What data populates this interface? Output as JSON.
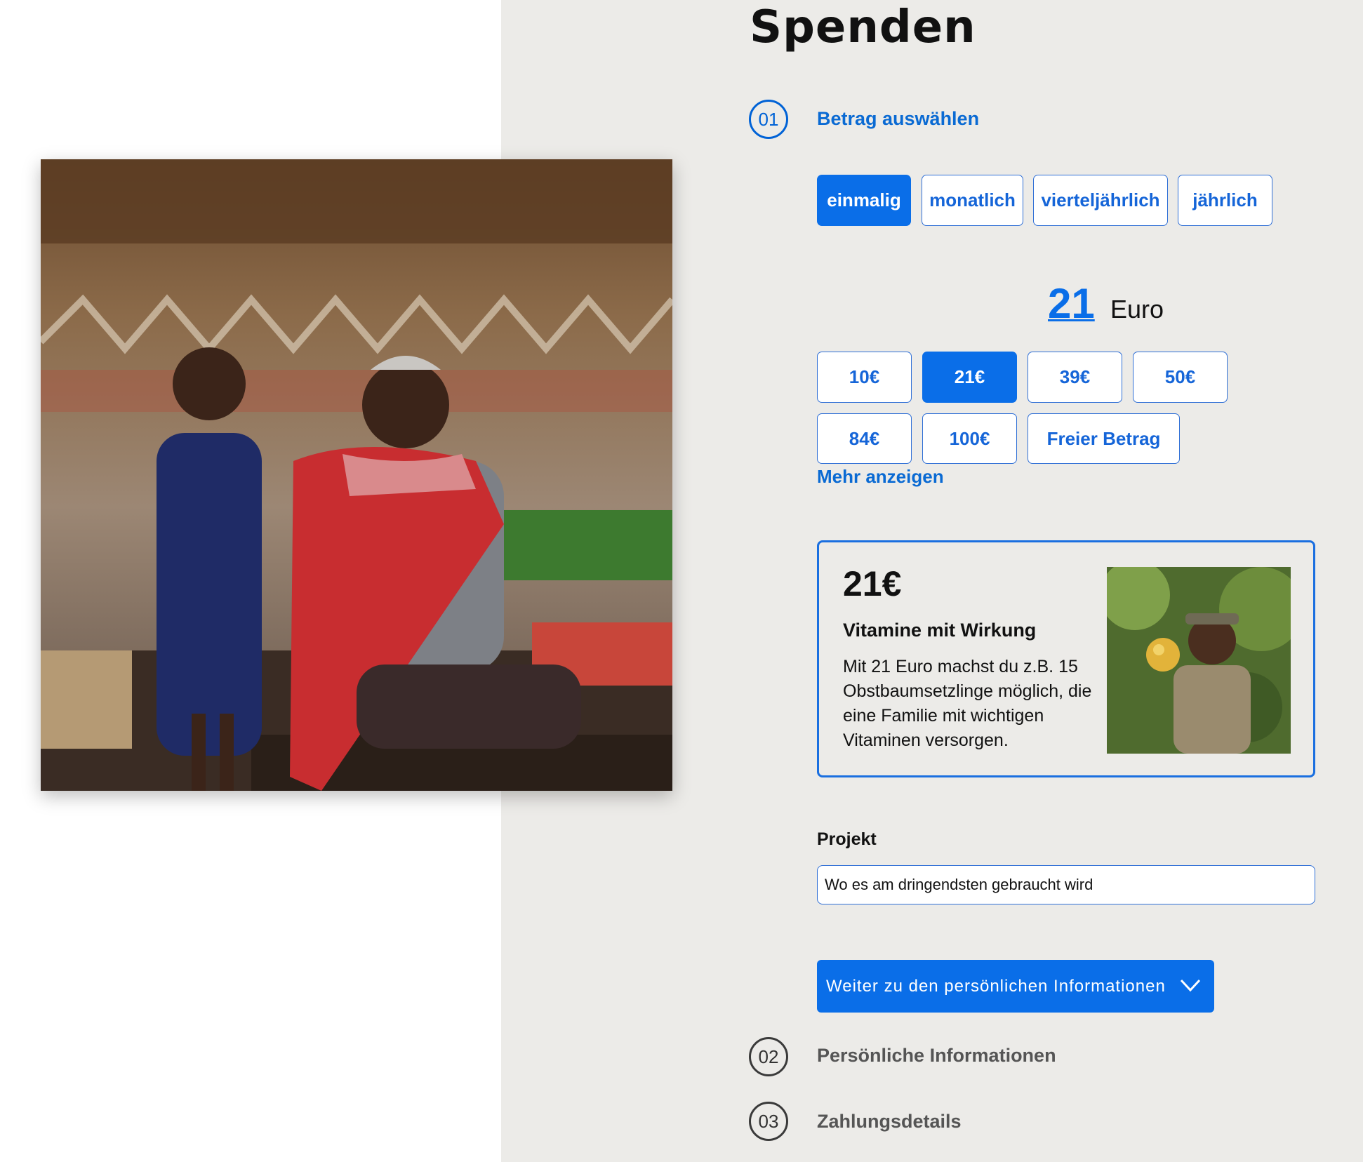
{
  "page": {
    "title": "Spenden"
  },
  "steps": [
    {
      "number": "01",
      "label": "Betrag auswählen",
      "active": true
    },
    {
      "number": "02",
      "label": "Persönliche Informationen",
      "active": false
    },
    {
      "number": "03",
      "label": "Zahlungsdetails",
      "active": false
    }
  ],
  "frequency": {
    "options": [
      "einmalig",
      "monatlich",
      "vierteljährlich",
      "jährlich"
    ],
    "selected": "einmalig"
  },
  "amount": {
    "value": "21",
    "unit": "Euro"
  },
  "presets": {
    "options": [
      "10€",
      "21€",
      "39€",
      "50€",
      "84€",
      "100€",
      "Freier Betrag"
    ],
    "selected": "21€",
    "more_label": "Mehr anzeigen"
  },
  "impact": {
    "amount": "21€",
    "title": "Vitamine mit Wirkung",
    "text": "Mit 21 Euro machst du z.B. 15 Obstbaumsetzlinge möglich, die eine Familie mit wichtigen Vitaminen versorgen."
  },
  "project": {
    "label": "Projekt",
    "value": "Wo es am dringendsten gebraucht wird"
  },
  "continue_button": {
    "label": "Weiter zu den persönlichen Informationen"
  },
  "colors": {
    "accent": "#0a6ee8",
    "panel": "#ecebe8",
    "text": "#111111"
  },
  "icons": {
    "continue": "chevron-down-icon"
  }
}
